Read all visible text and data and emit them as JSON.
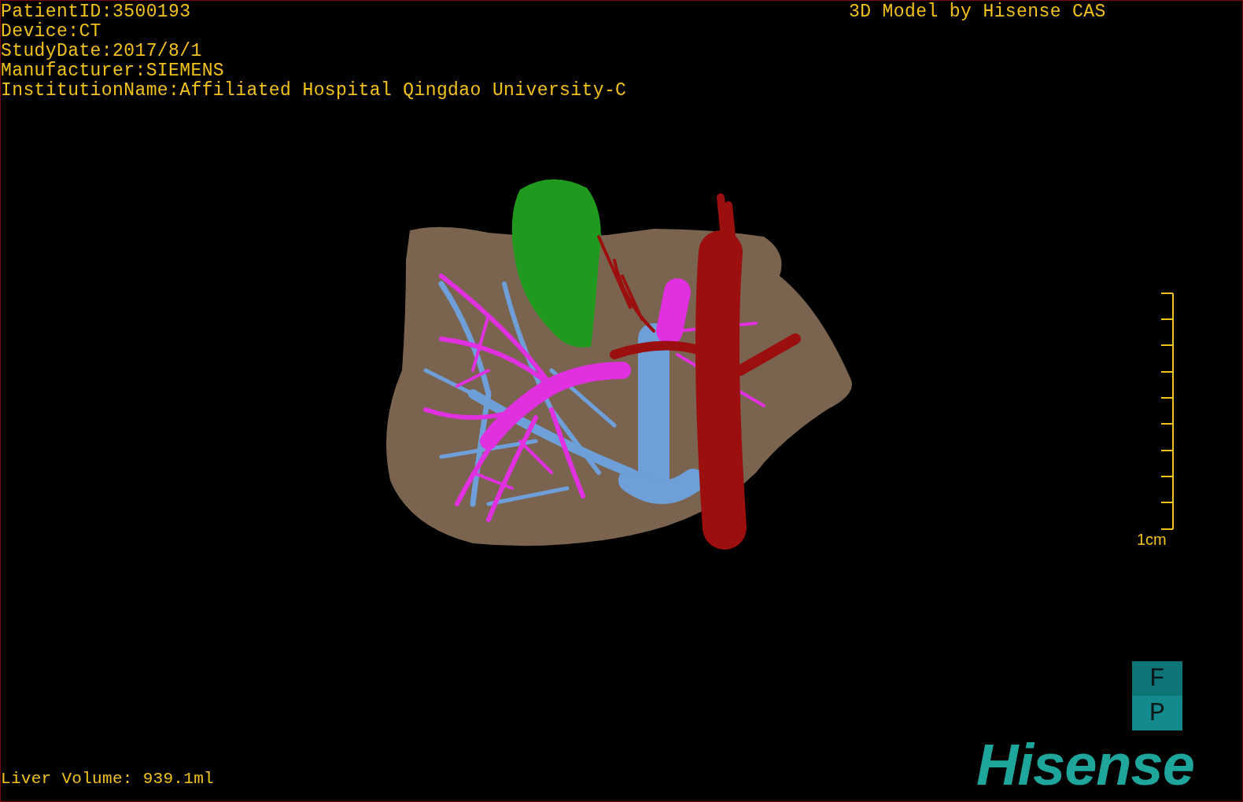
{
  "patient_info": [
    "PatientID:3500193",
    "Device:CT",
    "StudyDate:2017/8/1",
    "Manufacturer:SIEMENS",
    "InstitutionName:Affiliated Hospital Qingdao University-C"
  ],
  "title": "3D Model by Hisense CAS",
  "scale_bar": {
    "label": "1cm"
  },
  "orientation_cube": {
    "top": "F",
    "bottom": "P"
  },
  "liver_volume": "Liver Volume: 939.1ml",
  "logo": "Hisense"
}
